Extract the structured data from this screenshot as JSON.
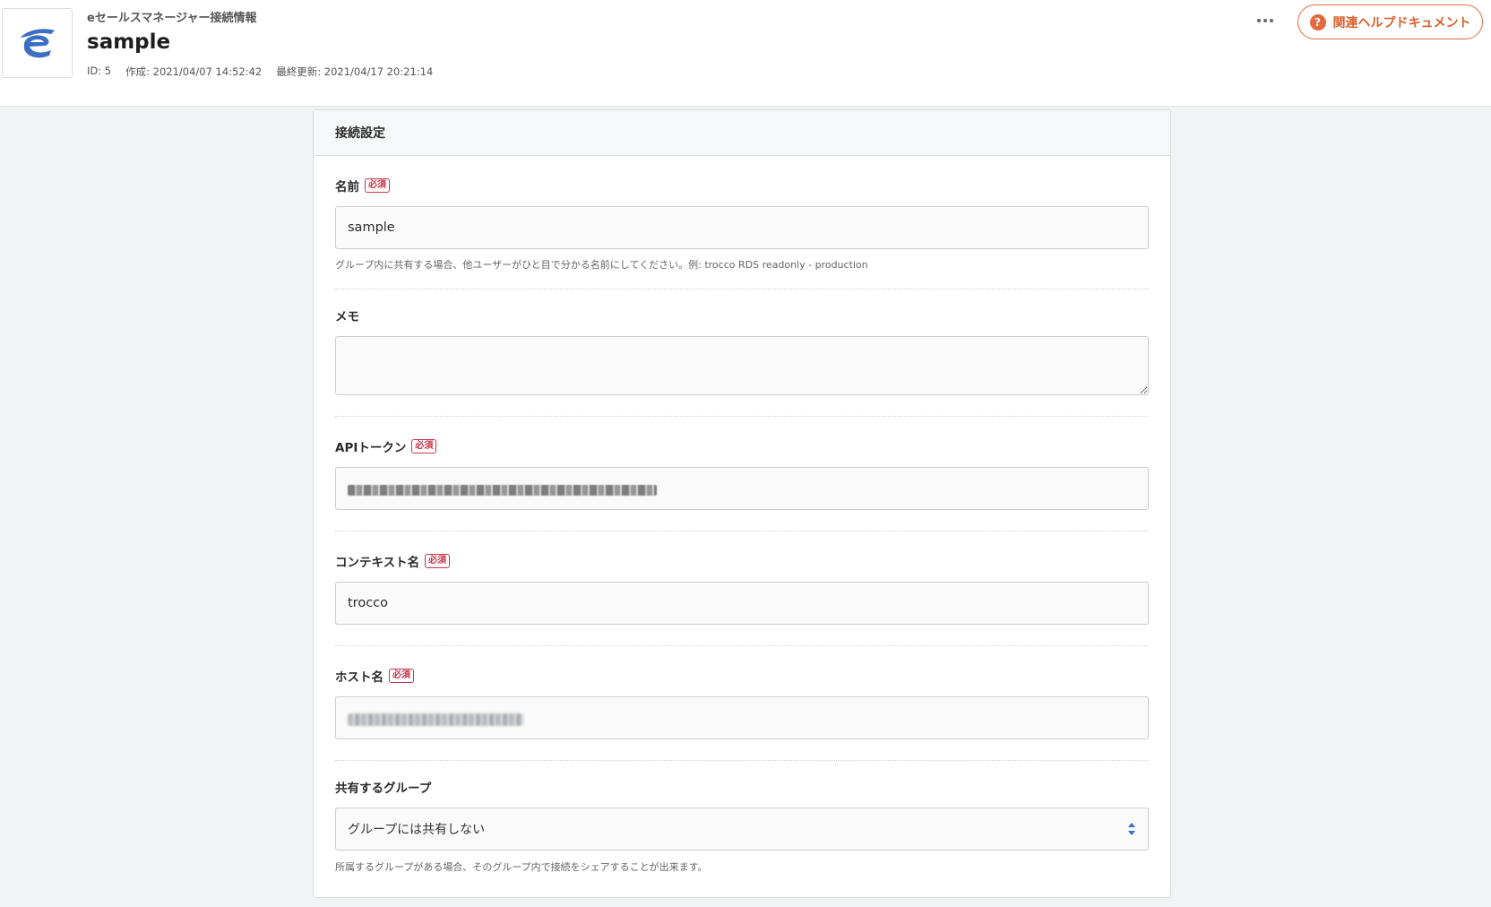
{
  "header": {
    "subtitle": "eセールスマネージャー接続情報",
    "title": "sample",
    "meta": {
      "id": "ID: 5",
      "created": "作成: 2021/04/07 14:52:42",
      "updated": "最終更新: 2021/04/17 20:21:14"
    },
    "help_button": "関連ヘルプドキュメント"
  },
  "card": {
    "title": "接続設定",
    "required_badge": "必須",
    "fields": {
      "name": {
        "label": "名前",
        "value": "sample",
        "help": "グループ内に共有する場合、他ユーザーがひと目で分かる名前にしてください。例: trocco RDS readonly - production"
      },
      "memo": {
        "label": "メモ",
        "value": ""
      },
      "api_token": {
        "label": "APIトークン"
      },
      "context": {
        "label": "コンテキスト名",
        "value": "trocco"
      },
      "host": {
        "label": "ホスト名"
      },
      "group": {
        "label": "共有するグループ",
        "selected": "グループには共有しない",
        "help": "所属するグループがある場合、そのグループ内で接続をシェアすることが出来ます。"
      }
    }
  },
  "colors": {
    "accent": "#e46a3e",
    "required": "#c8344a",
    "logo_blue": "#3a6fc4"
  }
}
